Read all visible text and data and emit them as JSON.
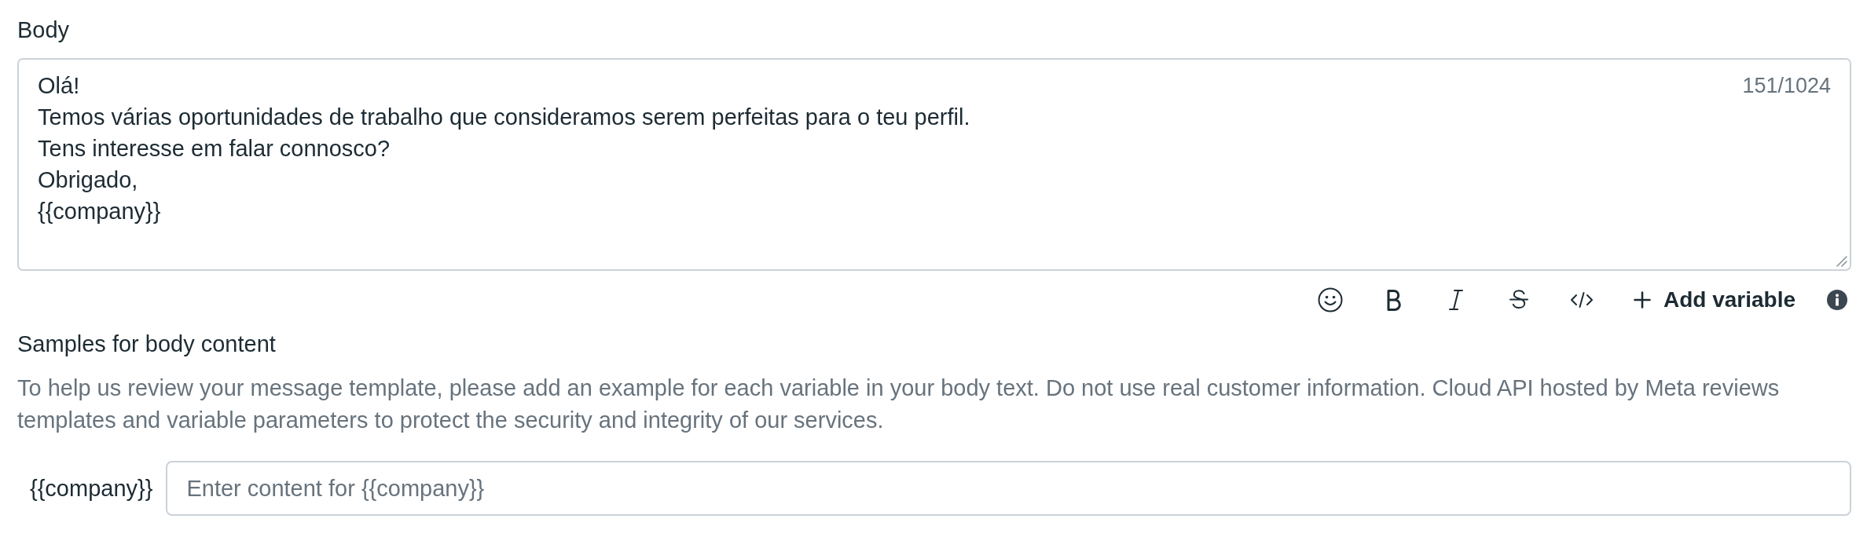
{
  "body": {
    "label": "Body",
    "text": "Olá!\nTemos várias oportunidades de trabalho que consideramos serem perfeitas para o teu perfil.\nTens interesse em falar connosco?\nObrigado,\n{{company}}",
    "counter": "151/1024"
  },
  "toolbar": {
    "add_variable": "Add variable"
  },
  "samples": {
    "title": "Samples for body content",
    "description": "To help us review your message template, please add an example for each variable in your body text. Do not use real customer information. Cloud API hosted by Meta reviews templates and variable parameters to protect the security and integrity of our services.",
    "fields": [
      {
        "label": "{{company}}",
        "placeholder": "Enter content for {{company}}"
      }
    ]
  }
}
